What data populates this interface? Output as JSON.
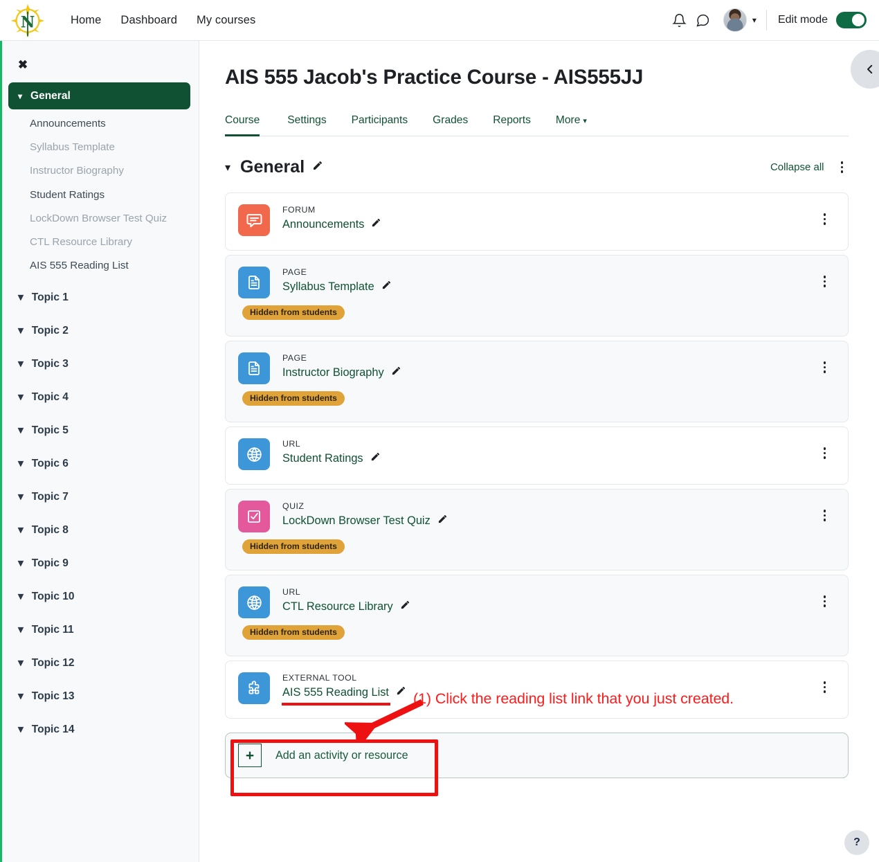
{
  "navbar": {
    "logo_alt": "nmu-compass-logo",
    "links": [
      {
        "label": "Home"
      },
      {
        "label": "Dashboard"
      },
      {
        "label": "My courses"
      }
    ],
    "notifications_icon": "bell-icon",
    "messages_icon": "message-icon",
    "avatar_label": "user-avatar",
    "edit_mode_label": "Edit mode",
    "edit_mode_on": true
  },
  "sidebar": {
    "close_label": "✖",
    "sections": [
      {
        "label": "General",
        "active": true,
        "items": [
          {
            "label": "Announcements",
            "dim": false
          },
          {
            "label": "Syllabus Template",
            "dim": true
          },
          {
            "label": "Instructor Biography",
            "dim": true
          },
          {
            "label": "Student Ratings",
            "dim": false
          },
          {
            "label": "LockDown Browser Test Quiz",
            "dim": true
          },
          {
            "label": "CTL Resource Library",
            "dim": true
          },
          {
            "label": "AIS 555 Reading List",
            "dim": false
          }
        ]
      },
      {
        "label": "Topic 1"
      },
      {
        "label": "Topic 2"
      },
      {
        "label": "Topic 3"
      },
      {
        "label": "Topic 4"
      },
      {
        "label": "Topic 5"
      },
      {
        "label": "Topic 6"
      },
      {
        "label": "Topic 7"
      },
      {
        "label": "Topic 8"
      },
      {
        "label": "Topic 9"
      },
      {
        "label": "Topic 10"
      },
      {
        "label": "Topic 11"
      },
      {
        "label": "Topic 12"
      },
      {
        "label": "Topic 13"
      },
      {
        "label": "Topic 14"
      }
    ]
  },
  "main": {
    "course_title": "AIS 555 Jacob's Practice Course - AIS555JJ",
    "tabs": [
      {
        "label": "Course",
        "active": true
      },
      {
        "label": "Settings",
        "active": false
      },
      {
        "label": "Participants",
        "active": false
      },
      {
        "label": "Grades",
        "active": false
      },
      {
        "label": "Reports",
        "active": false
      },
      {
        "label": "More",
        "active": false,
        "caret": true
      }
    ],
    "section": {
      "title": "General",
      "collapse_all": "Collapse all"
    },
    "activities": [
      {
        "type": "FORUM",
        "name": "Announcements",
        "icon": "forum-icon",
        "icon_color": "#f2684c",
        "hidden": false,
        "badge": null,
        "highlighted": false
      },
      {
        "type": "PAGE",
        "name": "Syllabus Template",
        "icon": "page-icon",
        "icon_color": "#3d96d8",
        "hidden": true,
        "badge": "Hidden from students",
        "highlighted": false
      },
      {
        "type": "PAGE",
        "name": "Instructor Biography",
        "icon": "page-icon",
        "icon_color": "#3d96d8",
        "hidden": true,
        "badge": "Hidden from students",
        "highlighted": false
      },
      {
        "type": "URL",
        "name": "Student Ratings",
        "icon": "globe-icon",
        "icon_color": "#3d96d8",
        "hidden": false,
        "badge": null,
        "highlighted": false
      },
      {
        "type": "QUIZ",
        "name": "LockDown Browser Test Quiz",
        "icon": "quiz-checkbox-icon",
        "icon_color": "#e4599b",
        "hidden": true,
        "badge": "Hidden from students",
        "highlighted": false
      },
      {
        "type": "URL",
        "name": "CTL Resource Library",
        "icon": "globe-icon",
        "icon_color": "#3d96d8",
        "hidden": true,
        "badge": "Hidden from students",
        "highlighted": false
      },
      {
        "type": "EXTERNAL TOOL",
        "name": "AIS 555 Reading List",
        "icon": "puzzle-piece-icon",
        "icon_color": "#3d96d8",
        "hidden": false,
        "badge": null,
        "highlighted": true
      }
    ],
    "add_activity_label": "Add an activity or resource"
  },
  "annotations": {
    "step_text": "(1) Click the reading list link that you just created.",
    "color": "#fe1b1b"
  },
  "controls": {
    "drawer_toggle_icon": "chevron-left-icon",
    "help_label": "?"
  },
  "colors": {
    "brand_green": "#0f5132",
    "accent_green": "#14b866",
    "annotation_red": "#ee1111",
    "badge_amber": "#e0a33a"
  }
}
